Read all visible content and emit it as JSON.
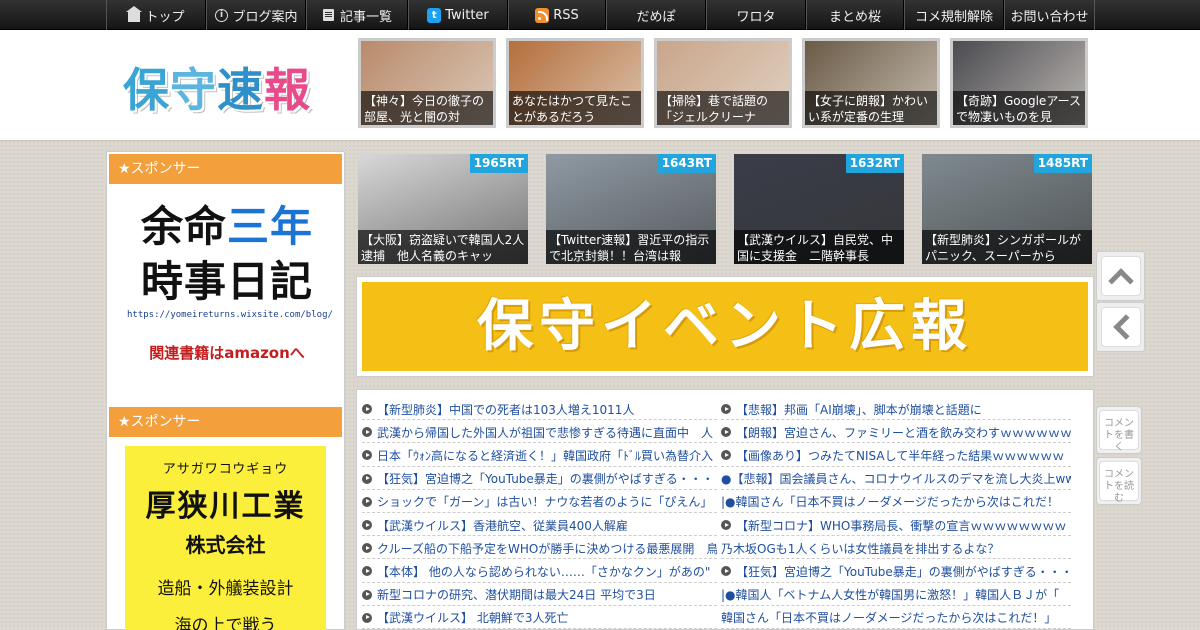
{
  "nav": {
    "items": [
      {
        "label": "トップ",
        "icon": "home-icon",
        "width": 100
      },
      {
        "label": "ブログ案内",
        "icon": "info-icon",
        "width": 100
      },
      {
        "label": "記事一覧",
        "icon": "document-icon",
        "width": 102
      },
      {
        "label": "Twitter",
        "icon": "twitter-icon",
        "width": 100
      },
      {
        "label": "RSS",
        "icon": "rss-icon",
        "width": 98
      },
      {
        "label": "だめぽ",
        "icon": "",
        "width": 100
      },
      {
        "label": "ワロタ",
        "icon": "",
        "width": 100
      },
      {
        "label": "まとめ桜",
        "icon": "",
        "width": 98
      },
      {
        "label": "コメ規制解除",
        "icon": "",
        "width": 100
      },
      {
        "label": "お問い合わせ",
        "icon": "",
        "width": 91
      }
    ]
  },
  "header": {
    "logo": [
      "保",
      "守",
      "速",
      "報"
    ],
    "thumbs": [
      {
        "caption": "【神々】今日の徹子の部屋、光と闇の対",
        "bg": "#b98a6a"
      },
      {
        "caption": "あなたはかつて見たことがあるだろう",
        "bg": "#b56f3c"
      },
      {
        "caption": "【掃除】巷で話題の「ジェルクリーナ",
        "bg": "#c9a58a"
      },
      {
        "caption": "【女子に朗報】かわいい系が定番の生理",
        "bg": "#6a5a46"
      },
      {
        "caption": "【奇跡】Googleアースで物凄いものを見",
        "bg": "#4a4a50"
      }
    ]
  },
  "sidebar": {
    "sponsor_label": "★スポンサー",
    "ad1": {
      "line1a": "余命",
      "line1b": "三年",
      "line2": "時事日記",
      "url": "https://yomeireturns.wixsite.com/blog/",
      "amazon": "関連書籍はamazonへ"
    },
    "ad2": {
      "kana": "アサガワコウギョウ",
      "name": "厚狭川工業",
      "corp": "株式会社",
      "desc": "造船・外艤装設計",
      "more": "海の上で戦う"
    }
  },
  "rt_items": [
    {
      "count": "1965RT",
      "caption": "【大阪】窃盗疑いで韓国人2人逮捕　他人名義のキャッ",
      "bg": "#d8d8d8"
    },
    {
      "count": "1643RT",
      "caption": "【Twitter速報】習近平の指示で北京封鎖！！台湾は報",
      "bg": "#8f9aa3"
    },
    {
      "count": "1632RT",
      "caption": "【武漢ウイルス】自民党、中国に支援金　二階幹事長",
      "bg": "#3a3d48"
    },
    {
      "count": "1485RT",
      "caption": "【新型肺炎】シンガポールがパニック、スーパーから",
      "bg": "#7f8a8f"
    }
  ],
  "banner": {
    "text": "保守イベント広報"
  },
  "news": {
    "left": [
      "【新型肺炎】中国での死者は103人増え1011人",
      "武漢から帰国した外国人が祖国で悲惨すぎる待遇に直面中　人",
      "日本「ｳｫﾝ高になると経済逝く！」韓国政府「ﾄﾞﾙ買い為替介入",
      "【狂気】宮迫博之「YouTube暴走」の裏側がやばすぎる・・・",
      "ショックで「ガーン」は古い！ナウな若者のように「ぴえん」",
      "【武漢ウイルス】香港航空、従業員400人解雇",
      "クルーズ船の下船予定をWHOが勝手に決めつける最悪展開　鳥",
      "【本体】 他の人なら認められない……「さかなクン」があの\"",
      "新型コロナの研究、潜伏期間は最大24日 平均で3日",
      "【武漢ウイルス】 北朝鮮で3人死亡"
    ],
    "right": [
      "【悲報】邦画「AI崩壊」、脚本が崩壊と話題に",
      "【朗報】宮迫さん、ファミリーと酒を飲み交わすｗｗｗｗｗｗ",
      "【画像あり】つみたてNISAして半年経った結果ｗｗｗｗｗｗ",
      "●【悲報】国会議員さん、コロナウイルスのデマを流し大炎上ww",
      "|●韓国さん「日本不買はノーダメージだったから次はこれだ！",
      "【新型コロナ】WHO事務局長、衝撃の宣言ｗｗｗｗｗｗｗｗ",
      "乃木坂OGも1人くらいは女性議員を排出するよな？",
      "【狂気】宮迫博之「YouTube暴走」の裏側がやばすぎる・・・",
      "|●韓国人「ベトナム人女性が韓国男に激怒！」韓国人ＢＪが「",
      "韓国さん「日本不買はノーダメージだったから次はこれだ！」"
    ],
    "right_bullets": [
      true,
      true,
      true,
      false,
      false,
      true,
      false,
      true,
      false,
      false
    ]
  },
  "side_buttons": {
    "comment_write": "コメントを書く",
    "comment_read": "コメントを読む"
  }
}
